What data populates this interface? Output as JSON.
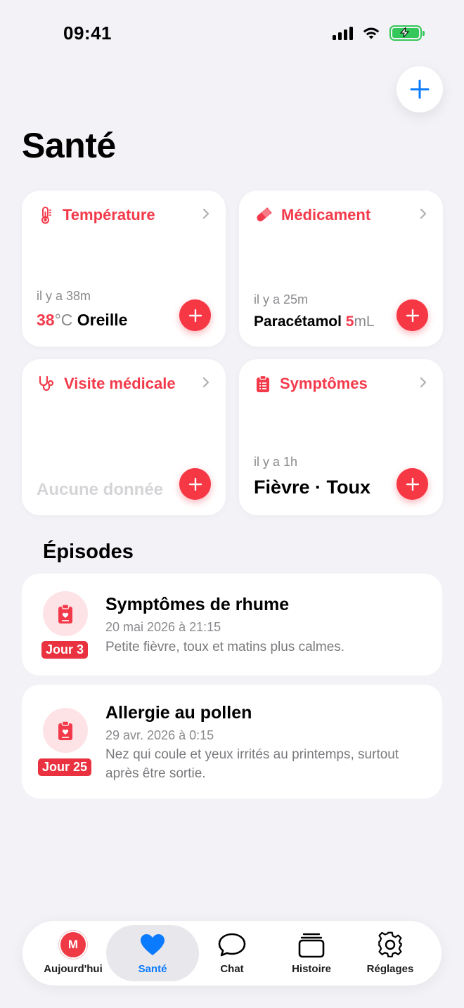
{
  "status": {
    "time": "09:41"
  },
  "header": {
    "title": "Santé"
  },
  "cards": {
    "temperature": {
      "title": "Température",
      "ago": "il y a 38m",
      "value": "38",
      "unit": "°C",
      "site": "Oreille",
      "icon": "thermometer-icon"
    },
    "medication": {
      "title": "Médicament",
      "ago": "il y a 25m",
      "name": "Paracétamol",
      "dose": "5",
      "unit": "mL",
      "icon": "pill-icon"
    },
    "visit": {
      "title": "Visite médicale",
      "empty": "Aucune donnée",
      "icon": "stethoscope-icon"
    },
    "symptoms": {
      "title": "Symptômes",
      "ago": "il y a 1h",
      "value": "Fièvre · Toux",
      "icon": "clipboard-icon"
    }
  },
  "episodes": {
    "title": "Épisodes",
    "items": [
      {
        "title": "Symptômes de rhume",
        "date": "20 mai 2026 à 21:15",
        "description": "Petite fièvre, toux et matins plus calmes.",
        "badge": "Jour 3"
      },
      {
        "title": "Allergie au pollen",
        "date": "29 avr. 2026 à 0:15",
        "description": "Nez qui coule et yeux irrités au printemps, surtout après être sortie.",
        "badge": "Jour 25"
      }
    ]
  },
  "tabs": [
    {
      "label": "Aujourd'hui",
      "avatar": "M",
      "icon": "avatar"
    },
    {
      "label": "Santé",
      "icon": "heart-icon",
      "active": true
    },
    {
      "label": "Chat",
      "icon": "chat-bubble-icon"
    },
    {
      "label": "Histoire",
      "icon": "stack-icon"
    },
    {
      "label": "Réglages",
      "icon": "gear-icon"
    }
  ],
  "colors": {
    "accent": "#f33a4b",
    "blue": "#0a7aff",
    "background": "#f2f2f7",
    "battery": "#34c759"
  }
}
